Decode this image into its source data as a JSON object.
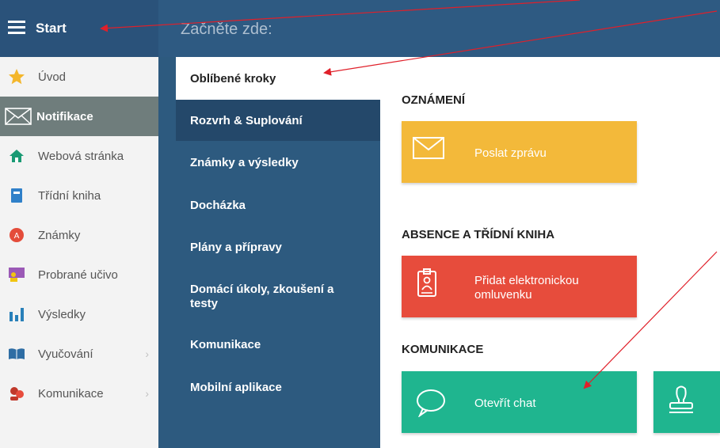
{
  "header": {
    "start_label": "Start",
    "breadcrumb": "Začněte zde:"
  },
  "sidebar": {
    "items": [
      {
        "label": "Úvod",
        "icon": "star-icon"
      },
      {
        "label": "Notifikace",
        "icon": "envelope-icon",
        "active": true
      },
      {
        "label": "Webová stránka",
        "icon": "home-icon"
      },
      {
        "label": "Třídní kniha",
        "icon": "book-icon"
      },
      {
        "label": "Známky",
        "icon": "grades-icon"
      },
      {
        "label": "Probrané učivo",
        "icon": "teacher-icon"
      },
      {
        "label": "Výsledky",
        "icon": "bar-chart-icon"
      },
      {
        "label": "Vyučování",
        "icon": "open-book-icon",
        "has_submenu": true
      },
      {
        "label": "Komunikace",
        "icon": "chat-people-icon",
        "has_submenu": true
      }
    ]
  },
  "menu": {
    "items": [
      {
        "label": "Oblíbené kroky",
        "selected": true
      },
      {
        "label": "Rozvrh & Suplování"
      },
      {
        "label": "Známky a výsledky"
      },
      {
        "label": "Docházka"
      },
      {
        "label": "Plány a přípravy"
      },
      {
        "label": "Domácí úkoly, zkoušení a testy"
      },
      {
        "label": "Komunikace"
      },
      {
        "label": "Mobilní aplikace"
      }
    ]
  },
  "content": {
    "sections": [
      {
        "title": "OZNÁMENÍ",
        "tiles": [
          {
            "label": "Poslat zprávu",
            "icon": "envelope-icon",
            "color": "#f3b93a"
          }
        ]
      },
      {
        "title": "ABSENCE A TŘÍDNÍ KNIHA",
        "tiles": [
          {
            "label": "Přidat elektronickou omluvenku",
            "icon": "id-badge-icon",
            "color": "#e74c3c"
          }
        ]
      },
      {
        "title": "KOMUNIKACE",
        "tiles": [
          {
            "label": "Otevřít chat",
            "icon": "chat-bubble-icon",
            "color": "#1fb58f"
          },
          {
            "label": "",
            "icon": "stamp-icon",
            "color": "#1fb58f"
          }
        ]
      }
    ]
  },
  "colors": {
    "header_bg": "#2e5a82",
    "menu_bg": "#2d5a7f",
    "active_sidebar": "#6f7d7c",
    "annotation_arrow": "#e0202a"
  }
}
